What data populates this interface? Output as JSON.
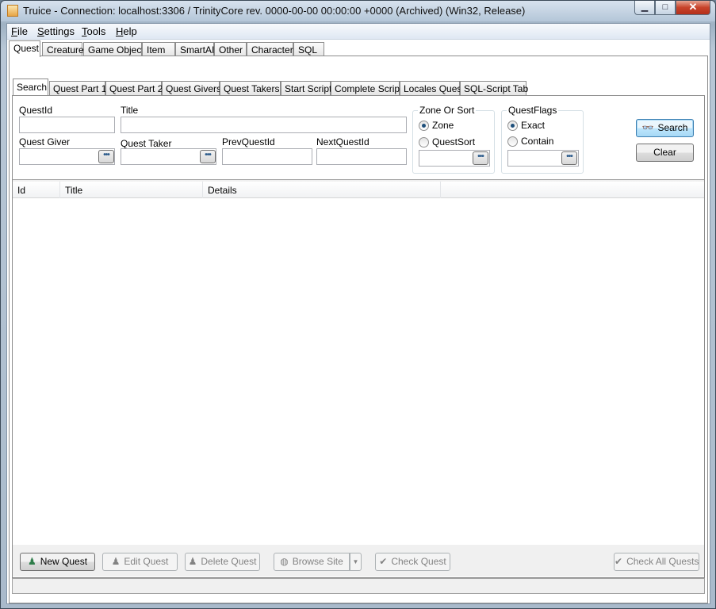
{
  "window": {
    "title": "Truice - Connection: localhost:3306 / TrinityCore rev. 0000-00-00 00:00:00 +0000 (Archived) (Win32, Release)",
    "controls": {
      "minimize": "▁",
      "maximize": "□",
      "close": "✕"
    }
  },
  "menu": {
    "file": {
      "underline": "F",
      "rest": "ile"
    },
    "settings": {
      "underline": "S",
      "rest": "ettings"
    },
    "tools": {
      "underline": "T",
      "rest": "ools"
    },
    "help": {
      "underline": "H",
      "rest": "elp"
    }
  },
  "top_tabs": [
    "Quest",
    "Creature",
    "Game Object",
    "Item",
    "SmartAI",
    "Other",
    "Character",
    "SQL"
  ],
  "sub_tabs": [
    "Search",
    "Quest Part 1",
    "Quest Part 2",
    "Quest Givers",
    "Quest Takers",
    "Start Script",
    "Complete Script",
    "Locales Quest",
    "SQL-Script Tab"
  ],
  "search": {
    "quest_id_label": "QuestId",
    "title_label": "Title",
    "quest_giver_label": "Quest Giver",
    "quest_taker_label": "Quest Taker",
    "prev_quest_label": "PrevQuestId",
    "next_quest_label": "NextQuestId",
    "ellipsis": "•••",
    "zone_group": {
      "title": "Zone Or Sort",
      "zone": "Zone",
      "quest_sort": "QuestSort"
    },
    "flags_group": {
      "title": "QuestFlags",
      "exact": "Exact",
      "contain": "Contain"
    },
    "search_button": "Search",
    "clear_button": "Clear"
  },
  "grid": {
    "columns": [
      "Id",
      "Title",
      "Details"
    ]
  },
  "actions": {
    "new_quest": "New Quest",
    "edit_quest": "Edit Quest",
    "delete_quest": "Delete Quest",
    "browse_site": "Browse Site",
    "dropdown_arrow": "▼",
    "check_quest": "Check Quest",
    "check_all_quests": "Check All Quests"
  },
  "icons": {
    "new_quest": "person-icon",
    "edit_quest": "person-icon",
    "delete_quest": "person-icon",
    "browse_site": "globe-icon",
    "check": "checkmark-icon",
    "search": "binoculars-icon"
  },
  "colors": {
    "title_bar": "#b4c6d8",
    "close_button": "#c7432a",
    "focus_button": "#3c7fb1"
  }
}
